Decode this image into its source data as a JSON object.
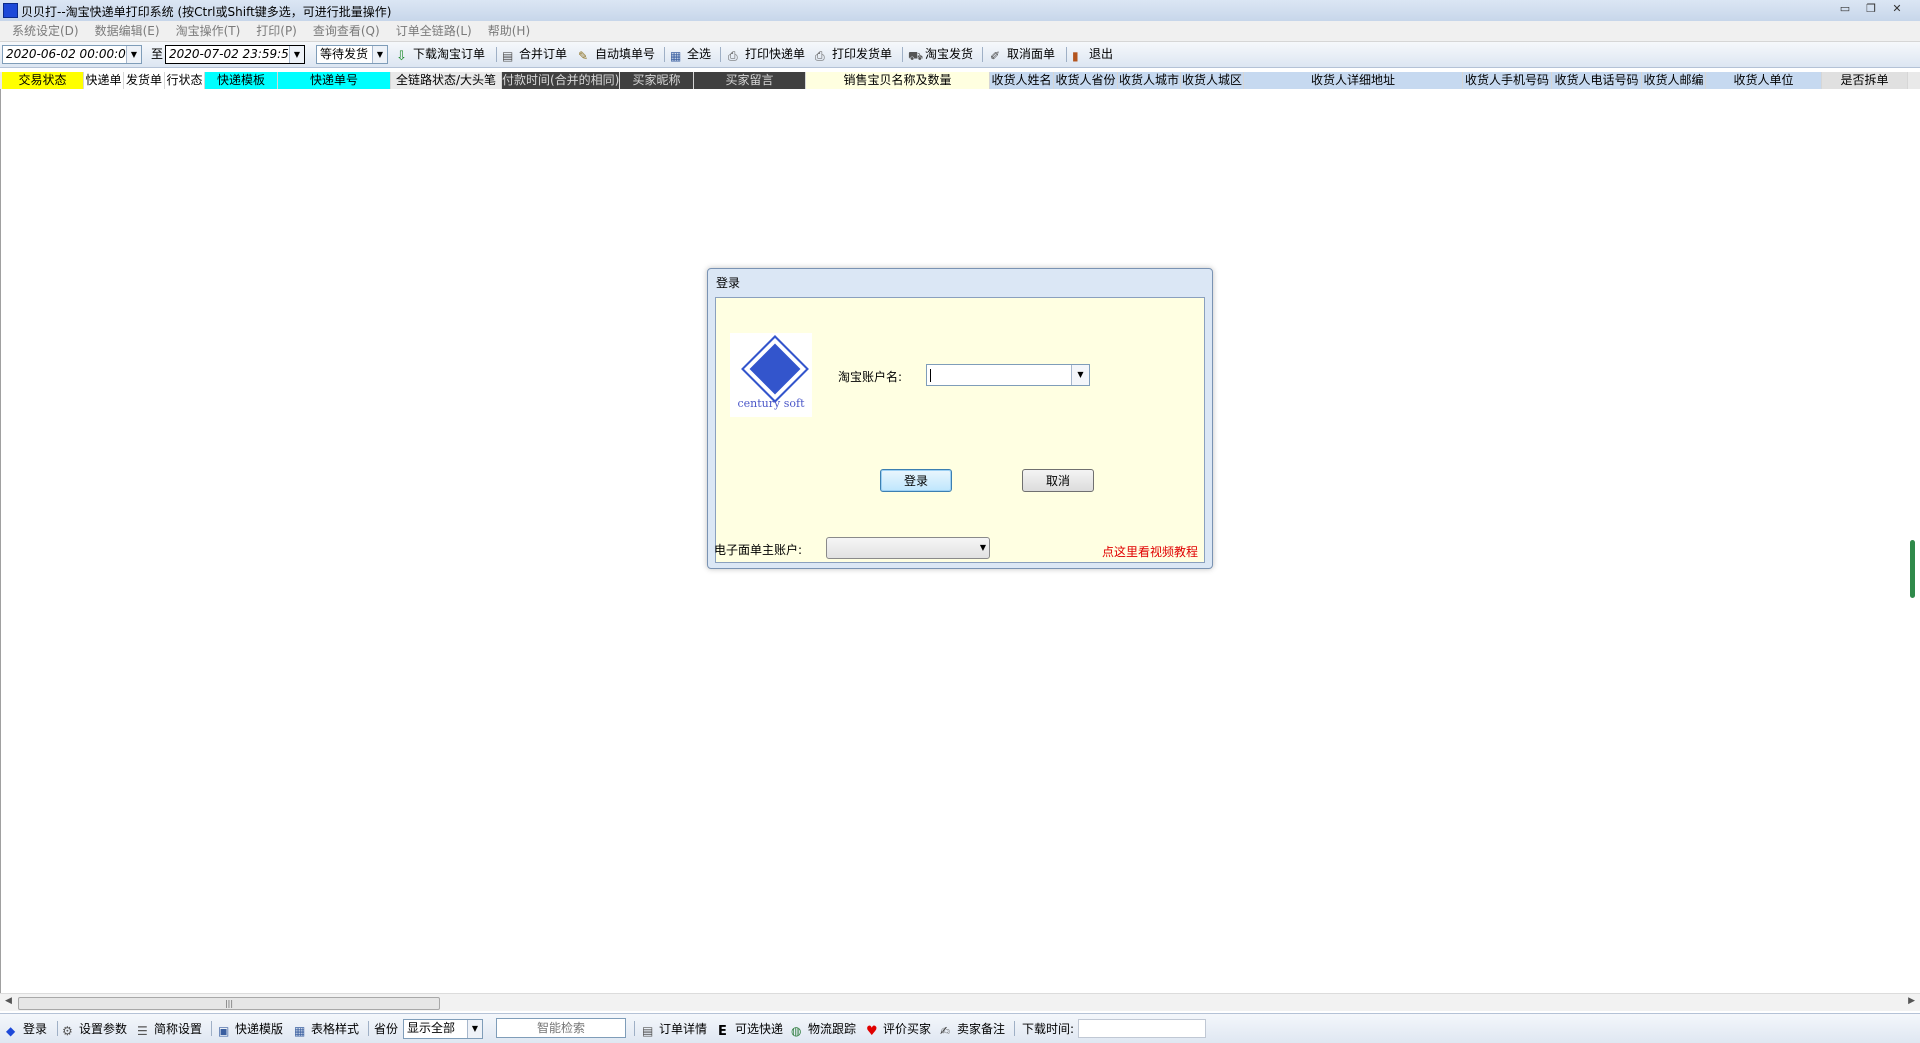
{
  "window": {
    "title": "贝贝打--淘宝快递单打印系统 (按Ctrl或Shift键多选，可进行批量操作)",
    "controls": [
      "▭",
      "❐",
      "✕"
    ]
  },
  "menu": [
    "系统设定(D)",
    "数据编辑(E)",
    "淘宝操作(T)",
    "打印(P)",
    "查询查看(Q)",
    "订单全链路(L)",
    "帮助(H)"
  ],
  "toolbar": {
    "date_from": "2020-06-02 00:00:00",
    "to_label": "至",
    "date_to": "2020-07-02 23:59:59",
    "status_filter": "等待发货",
    "buttons": [
      "下载淘宝订单",
      "合并订单",
      "自动填单号",
      "全选",
      "打印快递单",
      "打印发货单",
      "淘宝发货",
      "取消面单",
      "退出"
    ]
  },
  "columns": [
    {
      "label": "交易状态",
      "bg": "#ffff00"
    },
    {
      "label": "快递单",
      "bg": "#ffffff"
    },
    {
      "label": "发货单",
      "bg": "#ffffff"
    },
    {
      "label": "行状态",
      "bg": "#ffffff"
    },
    {
      "label": "快递模板",
      "bg": "#00ffff"
    },
    {
      "label": "快递单号",
      "bg": "#00ffff"
    },
    {
      "label": "全链路状态/大头笔",
      "bg": "#e9e9e9"
    },
    {
      "label": "付款时间(合并的相同)",
      "bg": "#404040"
    },
    {
      "label": "买家昵称",
      "bg": "#404040"
    },
    {
      "label": "买家留言",
      "bg": "#404040"
    },
    {
      "label": "销售宝贝名称及数量",
      "bg": "#ffffe0"
    },
    {
      "label": "收货人姓名",
      "bg": "#c6d9f0"
    },
    {
      "label": "收货人省份",
      "bg": "#c6d9f0"
    },
    {
      "label": "收货人城市",
      "bg": "#c6d9f0"
    },
    {
      "label": "收货人城区",
      "bg": "#c6d9f0"
    },
    {
      "label": "收货人详细地址",
      "bg": "#c6d9f0"
    },
    {
      "label": "收货人手机号码",
      "bg": "#c6d9f0"
    },
    {
      "label": "收货人电话号码",
      "bg": "#c6d9f0"
    },
    {
      "label": "收货人邮编",
      "bg": "#c6d9f0"
    },
    {
      "label": "收货人单位",
      "bg": "#c6d9f0"
    },
    {
      "label": "是否拆单",
      "bg": "#e0e0e0"
    }
  ],
  "dialog": {
    "title": "登录",
    "logo_text": "century soft",
    "account_label": "淘宝账户名:",
    "account_value": "",
    "login_button": "登录",
    "cancel_button": "取消",
    "ebill_label": "电子面单主账户:",
    "ebill_value": "",
    "tutorial_link": "点这里看视频教程"
  },
  "hscroll_grip": "|||",
  "statusbar": {
    "items": [
      "登录",
      "设置参数",
      "简称设置",
      "快递模版",
      "表格样式"
    ],
    "province_label": "省份",
    "province_value": "显示全部",
    "search_placeholder": "智能检索",
    "actions": [
      "订单详情",
      "可选快递",
      "物流跟踪",
      "评价买家",
      "卖家备注"
    ],
    "download_time_label": "下载时间:",
    "download_time_value": ""
  },
  "colors": {
    "dark_header_text": "#d8d8d8",
    "link_red": "#e00000",
    "accent_blue": "#3355cc"
  }
}
